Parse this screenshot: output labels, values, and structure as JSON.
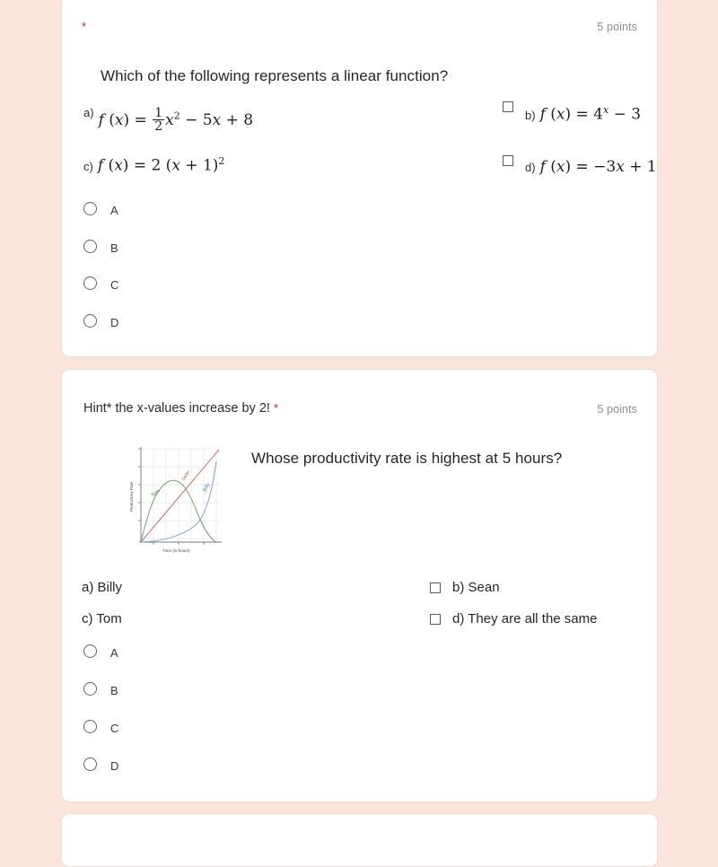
{
  "theme": {
    "page_background": "#fbe4dc",
    "card_background": "#ffffff",
    "required_star_color": "#b23c2a",
    "points_text_color": "#8e8e8e"
  },
  "questions": [
    {
      "id": "q1",
      "required_marker": "*",
      "points": "5 points",
      "title": "Which of the following represents a linear function?",
      "choices": [
        {
          "letter": "a)",
          "kind": "math",
          "text": "f (x) = 1/2 x² − 5x + 8"
        },
        {
          "letter": "b)",
          "kind": "math",
          "text": "f (x) = 4ˣ − 3"
        },
        {
          "letter": "c)",
          "kind": "math",
          "text": "f (x) = 2 (x + 1)²"
        },
        {
          "letter": "d)",
          "kind": "math",
          "text": "f (x) = −3x + 1"
        }
      ],
      "radio_options": [
        {
          "value": "A"
        },
        {
          "value": "B"
        },
        {
          "value": "C"
        },
        {
          "value": "D"
        }
      ]
    },
    {
      "id": "q2",
      "hint": "Hint* the x-values increase by 2!",
      "required_marker": "*",
      "points": "5 points",
      "title": "Whose productivity rate is highest at 5 hours?",
      "choices": [
        {
          "letter": "a)",
          "kind": "text",
          "text": "Billy"
        },
        {
          "letter": "b)",
          "kind": "text",
          "text": "Sean"
        },
        {
          "letter": "c)",
          "kind": "text",
          "text": "Tom"
        },
        {
          "letter": "d)",
          "kind": "text",
          "text": "They are all the same"
        }
      ],
      "radio_options": [
        {
          "value": "A"
        },
        {
          "value": "B"
        },
        {
          "value": "C"
        },
        {
          "value": "D"
        }
      ]
    }
  ],
  "chart_data": {
    "type": "line",
    "title": "",
    "xlabel": "Time (in hours)",
    "ylabel": "Productivity Rate",
    "xlim": [
      0,
      10
    ],
    "ylim": [
      0,
      100
    ],
    "grid": true,
    "legend": "inline-curve-labels",
    "x": [
      0,
      1,
      2,
      3,
      4,
      5,
      6,
      7,
      8,
      9,
      10
    ],
    "series": [
      {
        "name": "Tom",
        "color": "#7d9e74",
        "shape": "parabola",
        "values": [
          0,
          30,
          50,
          60,
          63,
          62,
          56,
          45,
          30,
          14,
          0
        ]
      },
      {
        "name": "Sean",
        "color": "#c0736c",
        "shape": "linear",
        "values": [
          0,
          10,
          20,
          30,
          40,
          50,
          60,
          70,
          80,
          90,
          100
        ]
      },
      {
        "name": "Billy",
        "color": "#7fa4c4",
        "shape": "exponential",
        "values": [
          0,
          1,
          2,
          4,
          7,
          11,
          18,
          28,
          45,
          68,
          95
        ]
      }
    ]
  }
}
